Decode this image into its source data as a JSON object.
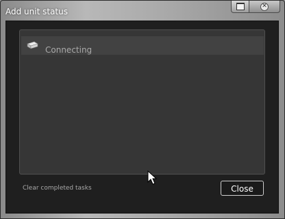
{
  "window": {
    "title": "Add unit status"
  },
  "tasks": [
    {
      "label": "Connecting",
      "icon": "drive-icon"
    }
  ],
  "footer": {
    "clear_label": "Clear completed tasks",
    "close_label": "Close"
  },
  "colors": {
    "client_background": "#1f1f1f",
    "panel_background": "#363636",
    "row_background": "#424242",
    "text_muted": "#a9a9a9",
    "button_border": "#d0d0d0"
  }
}
